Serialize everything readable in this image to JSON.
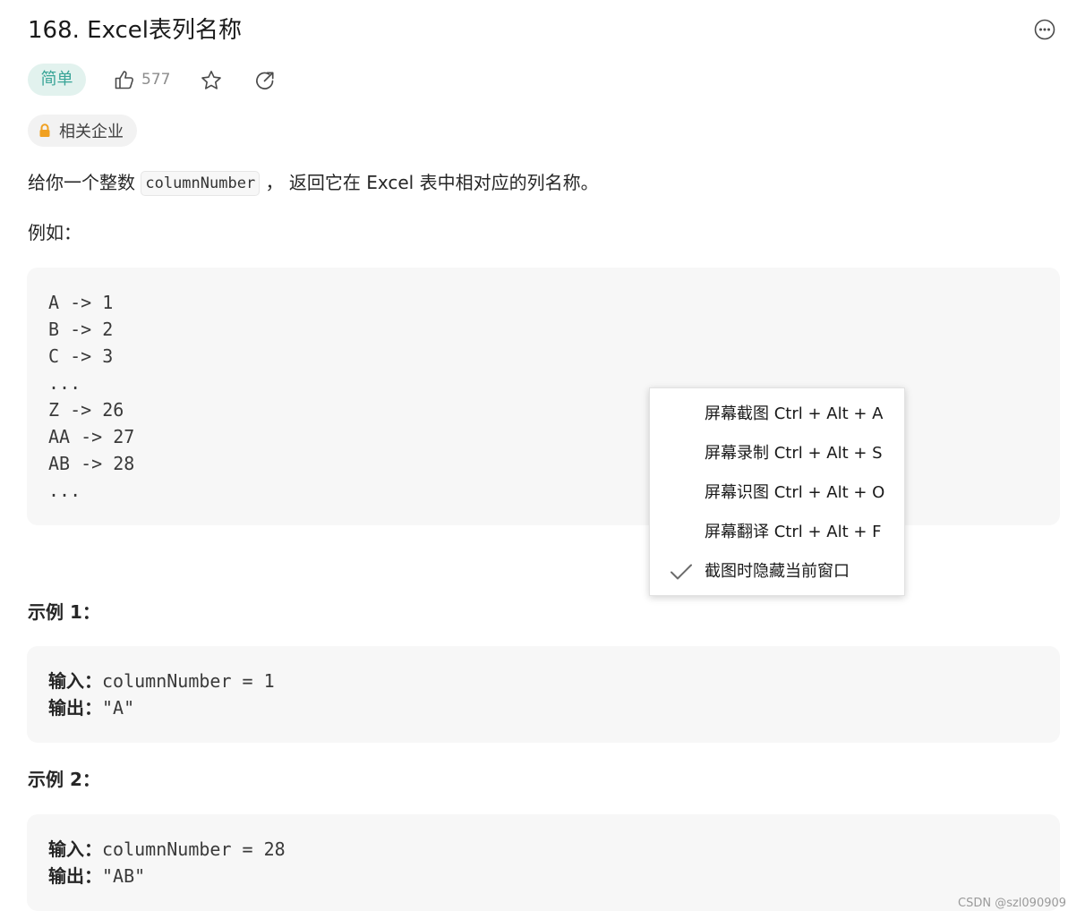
{
  "problem": {
    "title": "168. Excel表列名称",
    "difficulty": "简单",
    "likes": "577",
    "company_tag": "相关企业"
  },
  "description": {
    "prefix": "给你一个整数 ",
    "code": "columnNumber",
    "suffix": " ， 返回它在 Excel 表中相对应的列名称。",
    "for_example": "例如："
  },
  "mapping_lines": [
    "A -> 1",
    "B -> 2",
    "C -> 3",
    "...",
    "Z -> 26",
    "AA -> 27",
    "AB -> 28",
    "..."
  ],
  "examples": [
    {
      "heading": "示例 1：",
      "input_label": "输入：",
      "input_value": "columnNumber = 1",
      "output_label": "输出：",
      "output_value": "\"A\""
    },
    {
      "heading": "示例 2：",
      "input_label": "输入：",
      "input_value": "columnNumber = 28",
      "output_label": "输出：",
      "output_value": "\"AB\""
    }
  ],
  "context_menu": {
    "items": [
      "屏幕截图 Ctrl + Alt + A",
      "屏幕录制 Ctrl + Alt + S",
      "屏幕识图 Ctrl + Alt + O",
      "屏幕翻译 Ctrl + Alt + F",
      "截图时隐藏当前窗口"
    ]
  },
  "watermark": "CSDN @szl090909",
  "colors": {
    "difficulty_bg": "#e2f2ee",
    "difficulty_text": "#38a497",
    "lock_icon": "#f0a020",
    "code_bg": "#f7f7f7"
  },
  "icons": [
    "more-icon",
    "thumbs-up-icon",
    "star-icon",
    "share-icon",
    "lock-icon",
    "checkmark-icon"
  ]
}
